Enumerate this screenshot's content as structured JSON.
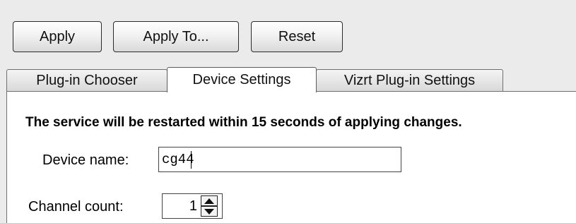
{
  "toolbar": {
    "apply_label": "Apply",
    "apply_to_label": "Apply To...",
    "reset_label": "Reset"
  },
  "tabs": [
    {
      "label": "Plug-in Chooser",
      "selected": false
    },
    {
      "label": "Device Settings",
      "selected": true
    },
    {
      "label": "Vizrt Plug-in Settings",
      "selected": false
    }
  ],
  "device_settings": {
    "notice": "The service will be restarted within 15 seconds of applying changes.",
    "device_name_label": "Device name:",
    "device_name_value": "cg44",
    "channel_count_label": "Channel count:",
    "channel_count_value": "1"
  },
  "icons": {
    "spin_up": "triangle-up-icon",
    "spin_down": "triangle-down-icon"
  }
}
